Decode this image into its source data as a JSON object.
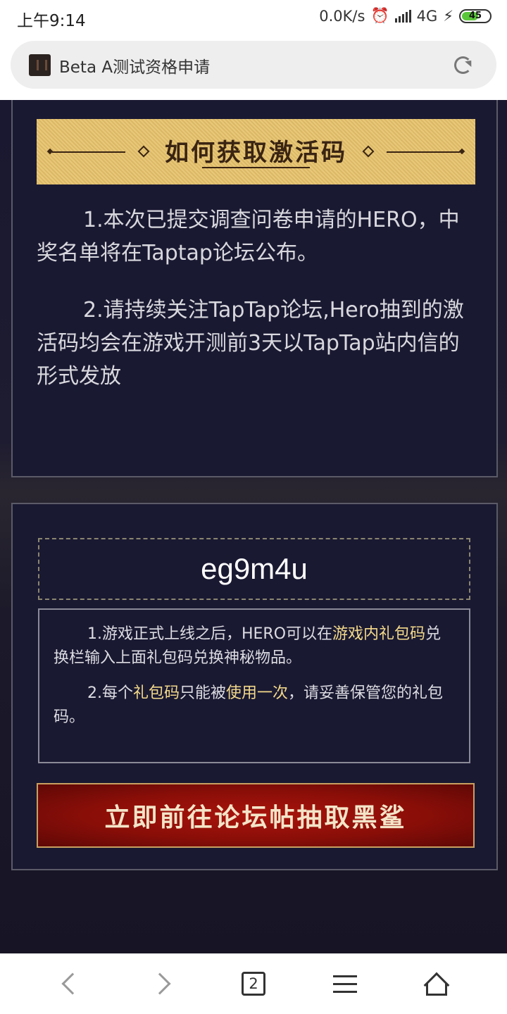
{
  "status_bar": {
    "time": "上午9:14",
    "net_speed": "0.0K/s",
    "network": "4G",
    "battery": "45"
  },
  "browser": {
    "page_title": "Beta A测试资格申请"
  },
  "section_how": {
    "banner_title": "如何获取激活码",
    "para1": "1.本次已提交调查问卷申请的HERO，中奖名单将在Taptap论坛公布。",
    "para2": "2.请持续关注TapTap论坛,Hero抽到的激活码均会在游戏开测前3天以TapTap站内信的形式发放"
  },
  "code_section": {
    "code": "eg9m4u",
    "note1": {
      "a": "1.游戏正式上线之后，HERO可以在",
      "b": "游戏内礼包码",
      "c": "兑换栏输入上面礼包码兑换神秘物品。"
    },
    "note2": {
      "a": "2.每个",
      "b": "礼包码",
      "c": "只能被",
      "d": "使用一次",
      "e": "，请妥善保管您的礼包码。"
    },
    "cta_label": "立即前往论坛帖抽取黑鲨"
  },
  "bottom_nav": {
    "tab_count": "2"
  }
}
